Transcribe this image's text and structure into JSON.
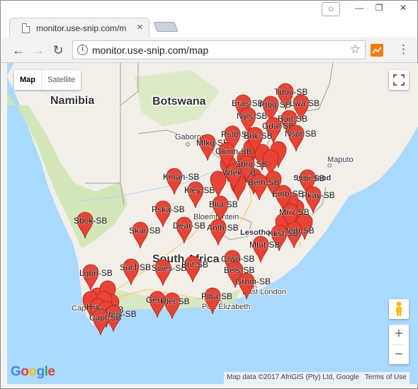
{
  "browser": {
    "tab_title": "monitor.use-snip.com/m",
    "tab_close": "×",
    "url": "monitor.use-snip.com/map",
    "info": "i",
    "star": "☆",
    "menu": "⋮",
    "back": "←",
    "forward": "→",
    "reload": "↻",
    "window_buttons": {
      "minimize": "—",
      "restore": "❐",
      "close": "✕"
    },
    "profile": "☺"
  },
  "map": {
    "type_buttons": {
      "map": "Map",
      "satellite": "Satellite"
    },
    "zoom_in": "+",
    "zoom_out": "−",
    "logo": {
      "letters": [
        "G",
        "o",
        "o",
        "g",
        "l",
        "e"
      ],
      "colors": [
        "#4285f4",
        "#ea4335",
        "#fbbc05",
        "#4285f4",
        "#34a853",
        "#ea4335"
      ]
    },
    "attribution": {
      "data": "Map data ©2017 AfriGIS (Pty) Ltd, Google",
      "terms": "Terms of Use"
    },
    "colors": {
      "land": "#f2efe9",
      "water": "#aadaff",
      "green": "#cde6b0",
      "marker": "#ea4335",
      "marker_stroke": "#a52714"
    },
    "countries": [
      {
        "name": "Namibia",
        "class": "country"
      },
      {
        "name": "Botswana",
        "class": "country"
      },
      {
        "name": "South Africa",
        "class": "country"
      },
      {
        "name": "Swaziland",
        "class": "country sm"
      },
      {
        "name": "Lesotho",
        "class": "country sm"
      }
    ],
    "cities": [
      "Gaborone",
      "Maputo",
      "Bloemfontein",
      "Port Elizabeth",
      "East London",
      "Cape Town",
      "burg"
    ],
    "markers": [
      {
        "label": "Tdou-SB"
      },
      {
        "label": "Eras-SB"
      },
      {
        "label": "Ptbg-SB"
      },
      {
        "label": "Lwa-SB"
      },
      {
        "label": "Nyls-SB"
      },
      {
        "label": "Bort-SB"
      },
      {
        "label": "Gdal-SB"
      },
      {
        "label": "Mfkg-SB"
      },
      {
        "label": "Rstb-SB"
      },
      {
        "label": "Bnk-SB"
      },
      {
        "label": "Nspt-SB"
      },
      {
        "label": "Oknm-SB"
      },
      {
        "label": "Kman-SB"
      },
      {
        "label": "Wtek-SB"
      },
      {
        "label": "Sbrg-SB"
      },
      {
        "label": "Beth-SB"
      },
      {
        "label": "Kley-SB"
      },
      {
        "label": "Ulbi-SB"
      },
      {
        "label": "Emb-SB"
      },
      {
        "label": "Pkay-SB"
      },
      {
        "label": "Sbok-SB"
      },
      {
        "label": "Blta-SB"
      },
      {
        "label": "Mriv-SB"
      },
      {
        "label": "Pska-SB"
      },
      {
        "label": "Skar-SB"
      },
      {
        "label": "Dear-SB"
      },
      {
        "label": "Anth-SB"
      },
      {
        "label": "Pmb-SB"
      },
      {
        "label": "Kkst-SB"
      },
      {
        "label": "Mtut-SB"
      },
      {
        "label": "Ctwn-SB"
      },
      {
        "label": "SutJ-SB"
      },
      {
        "label": "Swes-SB"
      },
      {
        "label": "Bnt-SB"
      },
      {
        "label": "Lgbn-SB"
      },
      {
        "label": "Bels-SB"
      },
      {
        "label": "Grhm-SB"
      },
      {
        "label": "Plba-SB"
      },
      {
        "label": "Geo-SB"
      },
      {
        "label": "Plet-SB"
      },
      {
        "label": "Hrm-SB"
      },
      {
        "label": "Tpe-SB"
      },
      {
        "label": "Ghus-SB"
      },
      {
        "label": "Capt-SB"
      }
    ]
  }
}
